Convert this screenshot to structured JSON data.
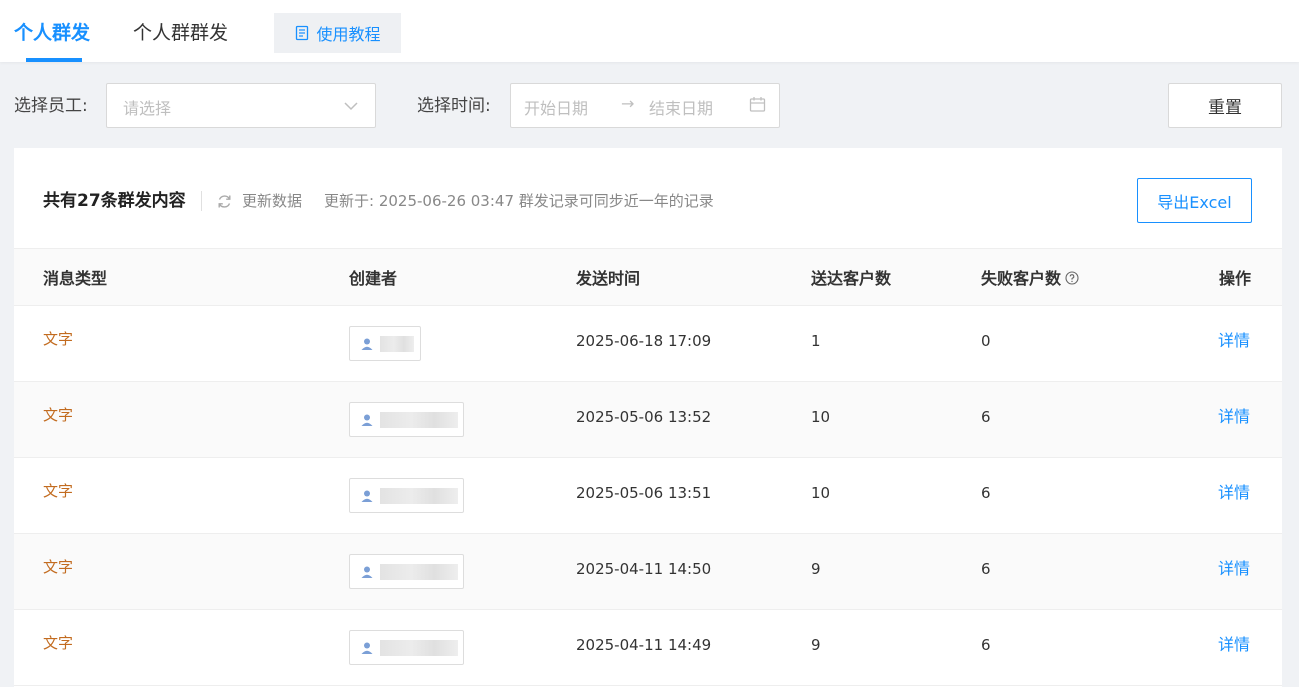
{
  "tabs": [
    {
      "label": "个人群发",
      "active": true
    },
    {
      "label": "个人群群发",
      "active": false
    }
  ],
  "tutorial_label": "使用教程",
  "filters": {
    "employee_label": "选择员工:",
    "employee_placeholder": "请选择",
    "time_label": "选择时间:",
    "start_placeholder": "开始日期",
    "arrow": "→",
    "end_placeholder": "结束日期",
    "reset_label": "重置"
  },
  "summary": {
    "title": "共有27条群发内容",
    "refresh_label": "更新数据",
    "updated_text": "更新于: 2025-06-26 03:47 群发记录可同步近一年的记录",
    "export_label": "导出Excel"
  },
  "table": {
    "columns": [
      "消息类型",
      "创建者",
      "发送时间",
      "送达客户数",
      "失败客户数",
      "操作"
    ],
    "rows": [
      {
        "type": "文字",
        "time": "2025-06-18 17:09",
        "delivered": "1",
        "failed": "0",
        "action": "详情"
      },
      {
        "type": "文字",
        "time": "2025-05-06 13:52",
        "delivered": "10",
        "failed": "6",
        "action": "详情"
      },
      {
        "type": "文字",
        "time": "2025-05-06 13:51",
        "delivered": "10",
        "failed": "6",
        "action": "详情"
      },
      {
        "type": "文字",
        "time": "2025-04-11 14:50",
        "delivered": "9",
        "failed": "6",
        "action": "详情"
      },
      {
        "type": "文字",
        "time": "2025-04-11 14:49",
        "delivered": "9",
        "failed": "6",
        "action": "详情"
      }
    ]
  },
  "colors": {
    "accent": "#1890ff",
    "type_text": "#c26b1f",
    "background": "#f0f2f5"
  }
}
